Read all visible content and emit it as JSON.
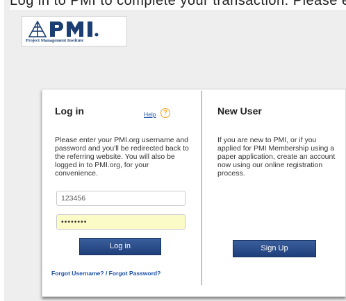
{
  "top_banner": {
    "text": "Log in to PMI to complete your transaction. Please enter"
  },
  "logo": {
    "mark_text": "PMI",
    "subtitle": "Project Management Institute"
  },
  "login": {
    "title": "Log in",
    "help_label": "Help",
    "help_icon_glyph": "?",
    "description": "Please enter your PMI.org username and password and you'll be redirected back to the referring website. You will also be logged in to PMI.org, for your convenience.",
    "username_value": "123456",
    "password_value": "••••••••",
    "button_label": "Log in",
    "forgot_username": "Forgot Username?",
    "forgot_separator": " / ",
    "forgot_password": "Forgot Password?"
  },
  "new_user": {
    "title": "New User",
    "description": "If you are new to PMI, or if you applied for PMI Membership using a paper application, create an account now using our online registration process.",
    "button_label": "Sign Up"
  },
  "colors": {
    "button_blue": "#1f3f7a",
    "link_blue": "#1a4fa8",
    "help_orange": "#f0a020",
    "password_bg": "#fbfbc7",
    "page_bg": "#eeeeee"
  }
}
